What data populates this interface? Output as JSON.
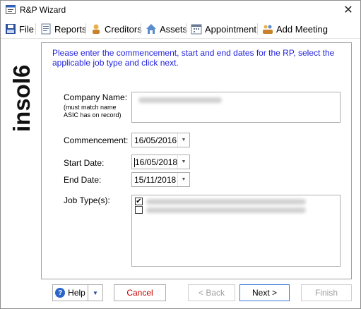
{
  "window": {
    "title": "R&P Wizard",
    "close_glyph": "✕"
  },
  "menu": {
    "file": "File",
    "reports": "Reports",
    "creditors": "Creditors",
    "assets": "Assets",
    "appointment": "Appointment",
    "add_meeting": "Add Meeting"
  },
  "brand": {
    "logo_text": "insol6"
  },
  "instructions": "Please enter the commencement, start and end dates for the RP, select the applicable job type and click next.",
  "form": {
    "company_name_label": "Company Name:",
    "company_name_note_1": "(must match name",
    "company_name_note_2": "ASIC has on record)",
    "commencement_label": "Commencement:",
    "commencement_value": "16/05/2016",
    "start_label": "Start Date:",
    "start_value": "16/05/2018",
    "end_label": "End Date:",
    "end_value": "15/11/2018",
    "job_type_label": "Job Type(s):",
    "job_types": [
      {
        "checked": true
      },
      {
        "checked": false
      }
    ]
  },
  "buttons": {
    "help": "Help",
    "cancel": "Cancel",
    "back": "< Back",
    "next": "Next >",
    "finish": "Finish"
  },
  "colors": {
    "instructions": "#1f1fde",
    "cancel_text": "#c00000",
    "accent": "#2a64c8"
  }
}
